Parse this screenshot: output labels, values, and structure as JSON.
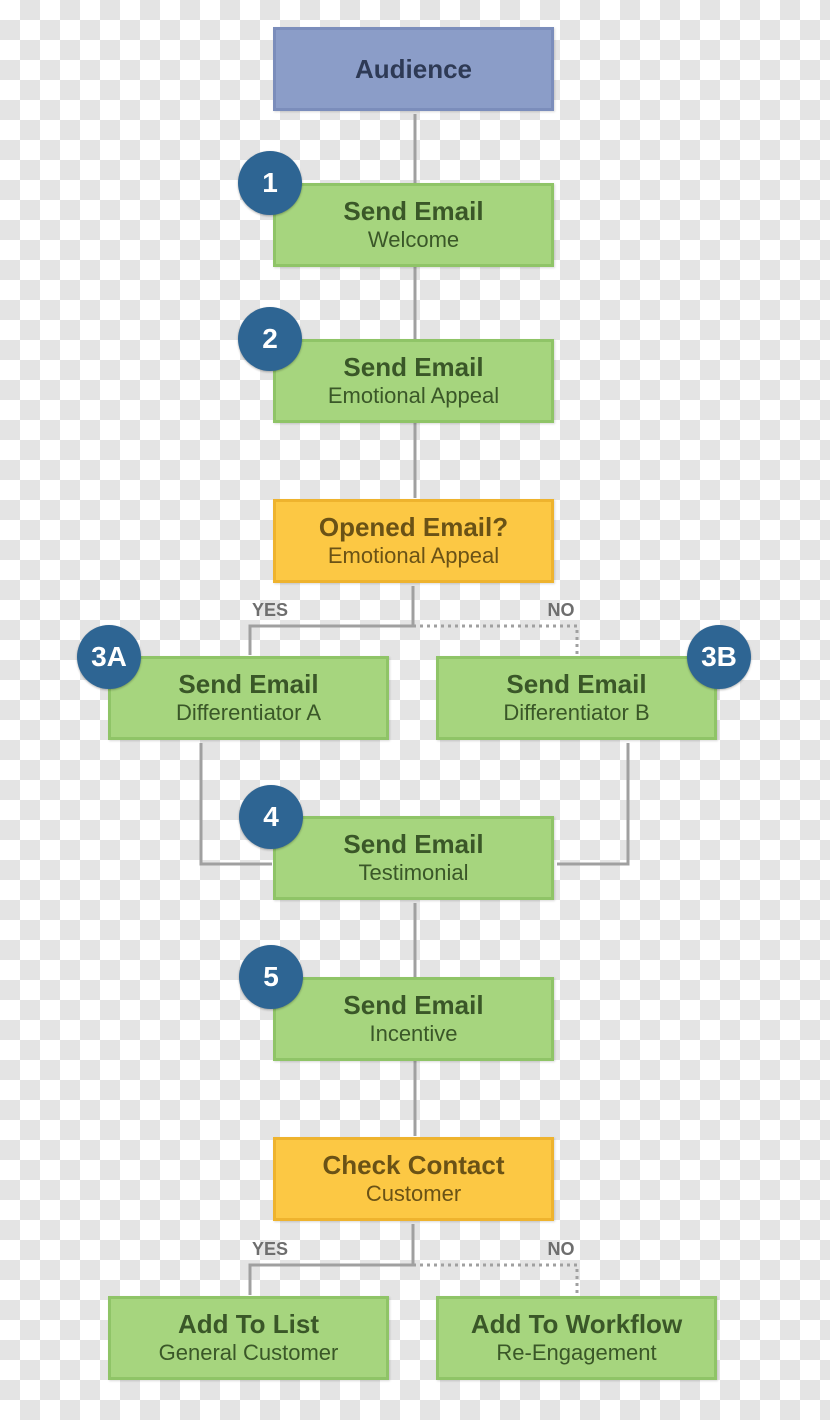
{
  "colors": {
    "action": "#a6d57e",
    "decision": "#fcc844",
    "start": "#8b9dc8",
    "badge": "#2e6593",
    "connector": "#a0a0a0"
  },
  "nodes": {
    "audience": {
      "title": "Audience"
    },
    "welcome": {
      "badge": "1",
      "title": "Send Email",
      "subtitle": "Welcome"
    },
    "emotional": {
      "badge": "2",
      "title": "Send Email",
      "subtitle": "Emotional Appeal"
    },
    "opened": {
      "title": "Opened Email?",
      "subtitle": "Emotional Appeal"
    },
    "diffA": {
      "badge": "3A",
      "title": "Send Email",
      "subtitle": "Differentiator A"
    },
    "diffB": {
      "badge": "3B",
      "title": "Send Email",
      "subtitle": "Differentiator B"
    },
    "testimonial": {
      "badge": "4",
      "title": "Send Email",
      "subtitle": "Testimonial"
    },
    "incentive": {
      "badge": "5",
      "title": "Send Email",
      "subtitle": "Incentive"
    },
    "check": {
      "title": "Check Contact",
      "subtitle": "Customer"
    },
    "addList": {
      "title": "Add To List",
      "subtitle": "General Customer"
    },
    "addWorkflow": {
      "title": "Add To Workflow",
      "subtitle": "Re-Engagement"
    }
  },
  "branches": {
    "yes1": "YES",
    "no1": "NO",
    "yes2": "YES",
    "no2": "NO"
  }
}
